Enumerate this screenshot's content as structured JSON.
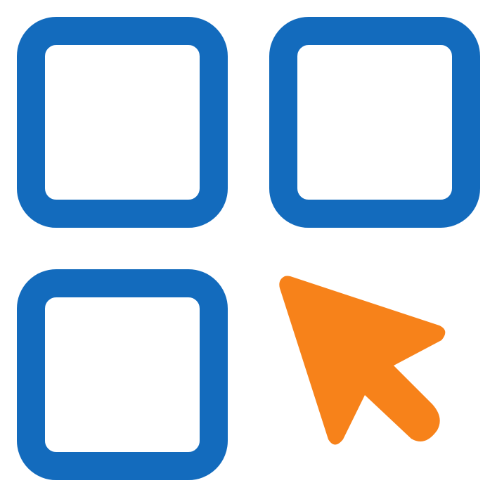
{
  "icon": {
    "name": "app-grid-select-icon",
    "tile_color": "#136bbd",
    "cursor_color": "#f7821a",
    "background": "#ffffff",
    "tiles": [
      "tile-top-left",
      "tile-top-right",
      "tile-bottom-left"
    ],
    "cursor": "cursor-arrow-icon"
  }
}
